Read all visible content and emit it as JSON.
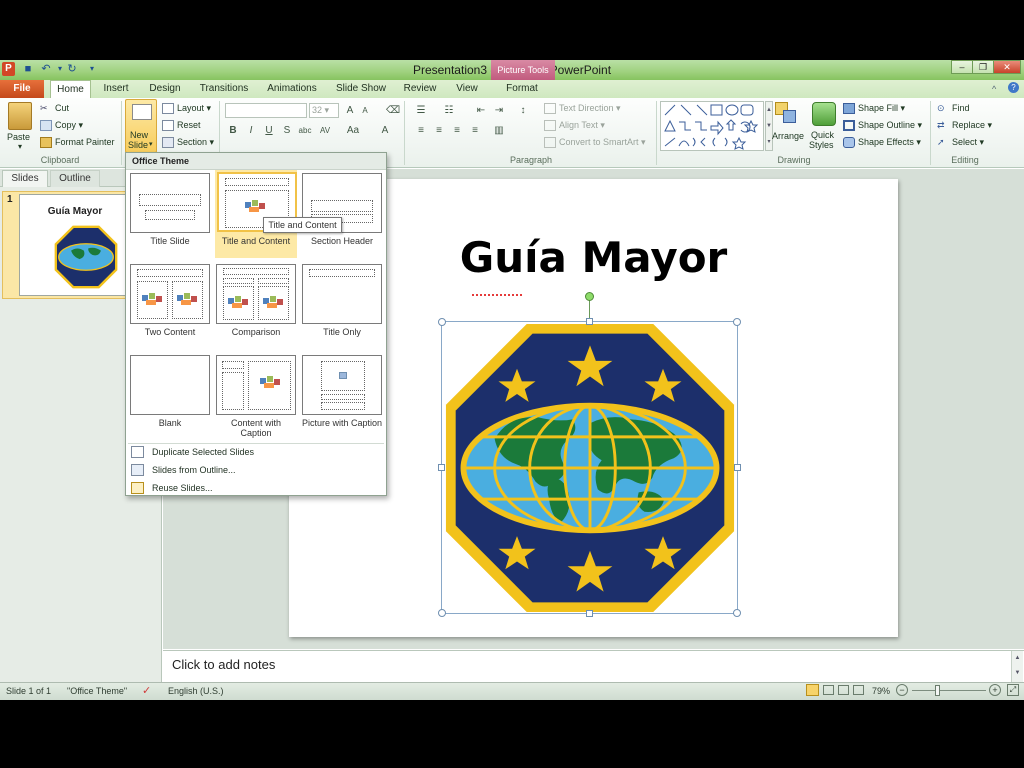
{
  "window": {
    "title": "Presentation3  -  Microsoft PowerPoint",
    "contextual_tab_group": "Picture Tools",
    "app_icon": "P",
    "controls": [
      "minimize-icon",
      "restore-icon",
      "close-icon"
    ]
  },
  "tabs": [
    "File",
    "Home",
    "Insert",
    "Design",
    "Transitions",
    "Animations",
    "Slide Show",
    "Review",
    "View",
    "Format"
  ],
  "active_tab": "Home",
  "ribbon": {
    "clipboard": {
      "paste": "Paste",
      "cut": "Cut",
      "copy": "Copy",
      "format_painter": "Format Painter",
      "label": "Clipboard"
    },
    "slides": {
      "new_slide_line1": "New",
      "new_slide_line2": "Slide",
      "layout": "Layout",
      "reset": "Reset",
      "section": "Section"
    },
    "font": {
      "size": "32"
    },
    "paragraph": {
      "text_direction": "Text Direction",
      "align_text": "Align Text",
      "convert_smartart": "Convert to SmartArt",
      "label": "Paragraph"
    },
    "drawing": {
      "arrange": "Arrange",
      "quick_styles_1": "Quick",
      "quick_styles_2": "Styles",
      "shape_fill": "Shape Fill",
      "shape_outline": "Shape Outline",
      "shape_effects": "Shape Effects",
      "label": "Drawing"
    },
    "editing": {
      "find": "Find",
      "replace": "Replace",
      "select": "Select",
      "label": "Editing"
    }
  },
  "left_pane": {
    "tabs": [
      "Slides",
      "Outline"
    ],
    "slide_number": "1",
    "thumb_title": "Guía Mayor"
  },
  "slide": {
    "title": "Guía Mayor"
  },
  "notes_placeholder": "Click to add notes",
  "status": {
    "slide_info": "Slide 1 of 1",
    "theme": "\"Office Theme\"",
    "language": "English (U.S.)",
    "zoom": "79%"
  },
  "gallery": {
    "header": "Office Theme",
    "layouts": [
      "Title Slide",
      "Title and Content",
      "Section Header",
      "Two Content",
      "Comparison",
      "Title Only",
      "Blank",
      "Content with Caption",
      "Picture with Caption"
    ],
    "selected": "Title and Content",
    "tooltip": "Title and Content",
    "menu": [
      "Duplicate Selected Slides",
      "Slides from Outline...",
      "Reuse Slides..."
    ]
  },
  "colors": {
    "emblem_navy": "#1c2f6b",
    "emblem_gold": "#f2c21b",
    "globe_water": "#4aaee0",
    "globe_land": "#1b7a3a",
    "title_bar_green": "#9fd17e",
    "file_tab": "#d35a26"
  }
}
